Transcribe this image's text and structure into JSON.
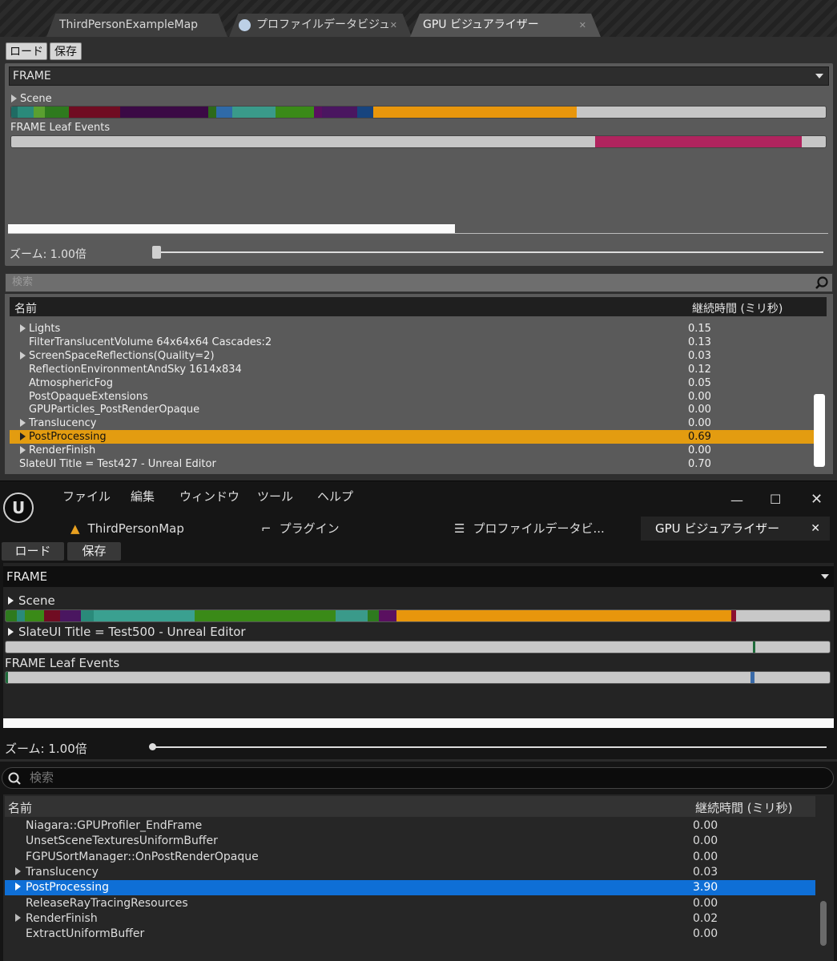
{
  "top": {
    "tabs": [
      {
        "label": "ThirdPersonExampleMap"
      },
      {
        "label": "プロファイルデータビジュ"
      },
      {
        "label": "GPU ビジュアライザー"
      }
    ],
    "toolbar": {
      "load": "ロード",
      "save": "保存"
    },
    "frame_select": "FRAME",
    "scene_label": "Scene",
    "leaf_label": "FRAME Leaf Events",
    "zoom_text": "ズーム: 1.00倍",
    "search_placeholder": "検索",
    "columns": {
      "name": "名前",
      "duration": "継続時間 (ミリ秒)"
    },
    "rows": [
      {
        "name": "Lights",
        "value": "0.15",
        "expandable": true
      },
      {
        "name": "FilterTranslucentVolume 64x64x64 Cascades:2",
        "value": "0.13",
        "expandable": false
      },
      {
        "name": "ScreenSpaceReflections(Quality=2)",
        "value": "0.03",
        "expandable": true
      },
      {
        "name": "ReflectionEnvironmentAndSky 1614x834",
        "value": "0.12",
        "expandable": false
      },
      {
        "name": "AtmosphericFog",
        "value": "0.05",
        "expandable": false
      },
      {
        "name": "PostOpaqueExtensions",
        "value": "0.00",
        "expandable": false
      },
      {
        "name": "GPUParticles_PostRenderOpaque",
        "value": "0.00",
        "expandable": false
      },
      {
        "name": "Translucency",
        "value": "0.00",
        "expandable": true
      },
      {
        "name": "PostProcessing",
        "value": "0.69",
        "expandable": true,
        "selected": true
      },
      {
        "name": "RenderFinish",
        "value": "0.00",
        "expandable": true
      },
      {
        "name": "SlateUI Title = Test427 - Unreal Editor",
        "value": "0.70",
        "expandable": false,
        "root": true
      }
    ]
  },
  "bottom": {
    "menu": [
      "ファイル",
      "編集",
      "ウィンドウ",
      "ツール",
      "ヘルプ"
    ],
    "tabs": [
      {
        "label": "ThirdPersonMap"
      },
      {
        "label": "プラグイン"
      },
      {
        "label": "プロファイルデータビ..."
      },
      {
        "label": "GPU ビジュアライザー"
      }
    ],
    "toolbar": {
      "load": "ロード",
      "save": "保存"
    },
    "frame_select": "FRAME",
    "scene_label": "Scene",
    "slate_label": "SlateUI Title = Test500 - Unreal Editor",
    "leaf_label": "FRAME Leaf Events",
    "zoom_text": "ズーム: 1.00倍",
    "search_placeholder": "検索",
    "columns": {
      "name": "名前",
      "duration": "継続時間 (ミリ秒)"
    },
    "rows": [
      {
        "name": "Niagara::GPUProfiler_EndFrame",
        "value": "0.00",
        "expandable": false
      },
      {
        "name": "UnsetSceneTexturesUniformBuffer",
        "value": "0.00",
        "expandable": false
      },
      {
        "name": "FGPUSortManager::OnPostRenderOpaque",
        "value": "0.00",
        "expandable": false
      },
      {
        "name": "Translucency",
        "value": "0.03",
        "expandable": true
      },
      {
        "name": "PostProcessing",
        "value": "3.90",
        "expandable": true,
        "selected": true
      },
      {
        "name": "ReleaseRayTracingResources",
        "value": "0.00",
        "expandable": false
      },
      {
        "name": "RenderFinish",
        "value": "0.02",
        "expandable": true
      },
      {
        "name": "ExtractUniformBuffer",
        "value": "0.00",
        "expandable": false
      }
    ]
  },
  "colors": {
    "top_selected": "#e39c10",
    "bottom_selected": "#0f6fd6",
    "leaf_highlight": "#b0245e",
    "orange": "#e8960c"
  }
}
